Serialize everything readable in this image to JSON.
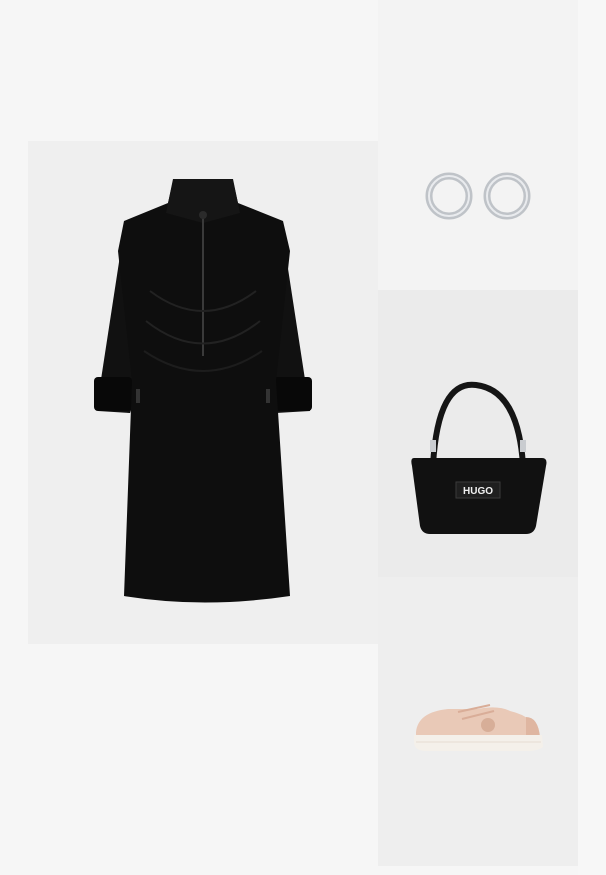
{
  "outfit": {
    "items": [
      {
        "key": "dress",
        "icon": "dress-image"
      },
      {
        "key": "earrings",
        "icon": "earrings-image"
      },
      {
        "key": "bag",
        "icon": "handbag-image",
        "brand_label": "HUGO"
      },
      {
        "key": "sneakers",
        "icon": "sneaker-image"
      }
    ]
  },
  "colors": {
    "page_bg": "#f6f6f6",
    "dress": "#0e0e0e",
    "bag": "#111111",
    "sneaker": "#e9c9b7",
    "sneaker_sole": "#f4f0ea",
    "silver": "#c9ccd0"
  }
}
